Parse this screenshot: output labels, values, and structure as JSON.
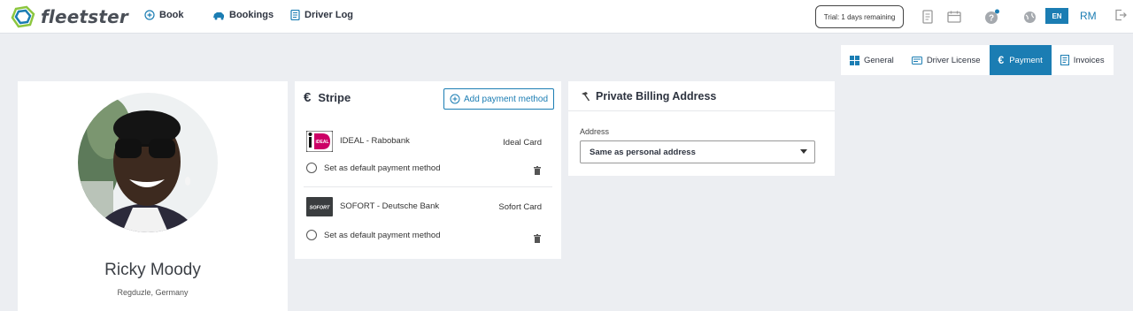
{
  "app": {
    "name": "fleetster"
  },
  "nav": [
    {
      "label": "Book",
      "icon": "plus-circle-icon"
    },
    {
      "label": "Bookings",
      "icon": "car-icon"
    },
    {
      "label": "Driver Log",
      "icon": "logbook-icon"
    }
  ],
  "topbar": {
    "trial": "Trial: 1 days remaining",
    "language": "EN",
    "user_initials": "RM"
  },
  "tabs": [
    {
      "label": "General",
      "icon": "grid-icon",
      "active": false
    },
    {
      "label": "Driver License",
      "icon": "license-card-icon",
      "active": false
    },
    {
      "label": "Payment",
      "icon": "euro-icon",
      "active": true
    },
    {
      "label": "Invoices",
      "icon": "invoice-icon",
      "active": false
    }
  ],
  "profile": {
    "name": "Ricky Moody",
    "location": "Regduzle, Germany"
  },
  "stripe": {
    "title": "Stripe",
    "add_label": "Add payment method",
    "methods": [
      {
        "name": "IDEAL - Rabobank",
        "type": "Ideal Card",
        "default_label": "Set as default payment method",
        "logo": "ideal-logo"
      },
      {
        "name": "SOFORT - Deutsche Bank",
        "type": "Sofort Card",
        "default_label": "Set as default payment method",
        "logo": "sofort-logo"
      }
    ]
  },
  "billing": {
    "title": "Private Billing Address",
    "address_label": "Address",
    "address_value": "Same as personal address"
  },
  "colors": {
    "accent": "#1b7db3",
    "background": "#eceef2"
  }
}
